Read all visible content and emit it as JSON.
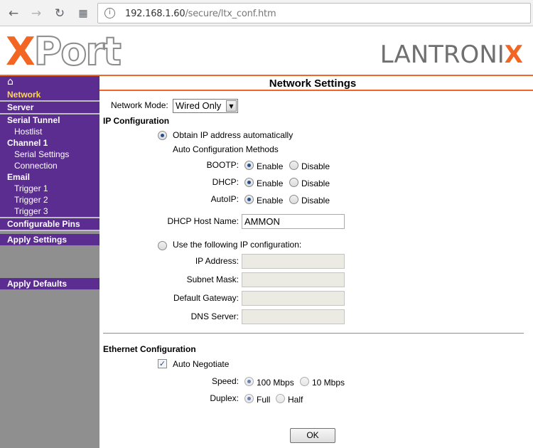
{
  "browser": {
    "url_host": "192.168.1.60",
    "url_path": "/secure/ltx_conf.htm"
  },
  "header": {
    "product_logo_x": "X",
    "product_logo_rest": "Port",
    "brand_logo": "LANTRONI",
    "brand_logo_x": "X"
  },
  "sidebar": {
    "items": {
      "network": "Network",
      "server": "Server",
      "serial_tunnel": "Serial Tunnel",
      "hostlist": "Hostlist",
      "channel1": "Channel 1",
      "serial_settings": "Serial Settings",
      "connection": "Connection",
      "email": "Email",
      "trigger1": "Trigger 1",
      "trigger2": "Trigger 2",
      "trigger3": "Trigger 3",
      "configurable_pins": "Configurable Pins",
      "apply_settings": "Apply Settings",
      "apply_defaults": "Apply Defaults"
    }
  },
  "main": {
    "title": "Network Settings",
    "network_mode_label": "Network Mode:",
    "network_mode_value": "Wired Only",
    "ip_config_title": "IP Configuration",
    "obtain_auto_label": "Obtain IP address automatically",
    "auto_methods_label": "Auto Configuration Methods",
    "bootp_label": "BOOTP:",
    "dhcp_label": "DHCP:",
    "autoip_label": "AutoIP:",
    "enable_label": "Enable",
    "disable_label": "Disable",
    "dhcp_host_label": "DHCP Host Name:",
    "dhcp_host_value": "AMMON",
    "use_following_label": "Use the following IP configuration:",
    "ip_address_label": "IP Address:",
    "subnet_mask_label": "Subnet Mask:",
    "default_gateway_label": "Default Gateway:",
    "dns_server_label": "DNS Server:",
    "ethernet_title": "Ethernet Configuration",
    "auto_negotiate_label": "Auto Negotiate",
    "speed_label": "Speed:",
    "speed_100": "100 Mbps",
    "speed_10": "10 Mbps",
    "duplex_label": "Duplex:",
    "duplex_full": "Full",
    "duplex_half": "Half",
    "ok_label": "OK"
  },
  "colors": {
    "accent": "#f26522",
    "sidebar_purple": "#5c2d91",
    "sidebar_gray": "#8f8f8f",
    "active_item": "#ffd84a"
  }
}
